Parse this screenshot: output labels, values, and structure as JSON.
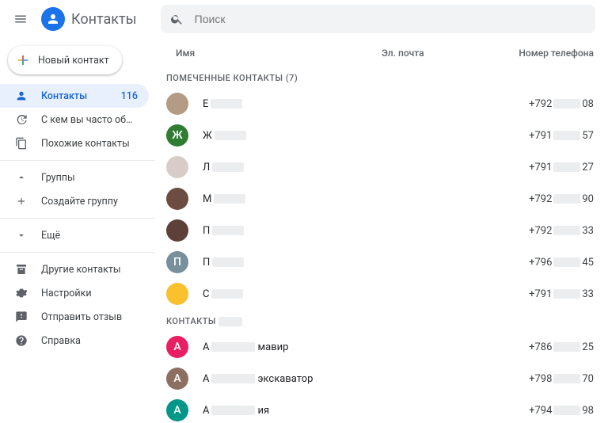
{
  "header": {
    "app_title": "Контакты",
    "search_placeholder": "Поиск"
  },
  "new_button": {
    "label": "Новый контакт"
  },
  "sidebar": {
    "items": [
      {
        "icon": "person",
        "label": "Контакты",
        "badge": "116",
        "active": true
      },
      {
        "icon": "history",
        "label": "С кем вы часто общае…"
      },
      {
        "icon": "copy",
        "label": "Похожие контакты"
      }
    ],
    "groups": [
      {
        "icon": "chev-up",
        "label": "Группы"
      },
      {
        "icon": "plus",
        "label": "Создайте группу"
      }
    ],
    "more": [
      {
        "icon": "chev-down",
        "label": "Ещё"
      }
    ],
    "footer": [
      {
        "icon": "archive",
        "label": "Другие контакты"
      },
      {
        "icon": "gear",
        "label": "Настройки"
      },
      {
        "icon": "feedback",
        "label": "Отправить отзыв"
      },
      {
        "icon": "help",
        "label": "Справка"
      }
    ]
  },
  "columns": {
    "name": "Имя",
    "email": "Эл. почта",
    "phone": "Номер телефона"
  },
  "sections": [
    {
      "title": "ПОМЕЧЕННЫЕ КОНТАКТЫ (7)",
      "contacts": [
        {
          "avatar_bg": "#b39b85",
          "initial": "",
          "name_prefix": "Е",
          "phone_prefix": "+792",
          "phone_suffix": "08"
        },
        {
          "avatar_bg": "#2e7d32",
          "initial": "Ж",
          "name_prefix": "Ж",
          "phone_prefix": "+791",
          "phone_suffix": "57"
        },
        {
          "avatar_bg": "#d7ccc8",
          "initial": "",
          "name_prefix": "Л",
          "phone_prefix": "+791",
          "phone_suffix": "27"
        },
        {
          "avatar_bg": "#6d4c41",
          "initial": "",
          "name_prefix": "М",
          "phone_prefix": "+792",
          "phone_suffix": "90"
        },
        {
          "avatar_bg": "#5d4037",
          "initial": "",
          "name_prefix": "П",
          "phone_prefix": "+792",
          "phone_suffix": "33"
        },
        {
          "avatar_bg": "#78909c",
          "initial": "П",
          "name_prefix": "П",
          "phone_prefix": "+796",
          "phone_suffix": "45"
        },
        {
          "avatar_bg": "#fbc02d",
          "initial": "",
          "name_prefix": "С",
          "phone_prefix": "+791",
          "phone_suffix": "33"
        }
      ]
    },
    {
      "title": "КОНТАКТЫ",
      "title_redacted": true,
      "contacts": [
        {
          "avatar_bg": "#e91e63",
          "initial": "А",
          "name_prefix": "А",
          "name_suffix": "мавир",
          "phone_prefix": "+786",
          "phone_suffix": "25"
        },
        {
          "avatar_bg": "#8d6e63",
          "initial": "А",
          "name_prefix": "А",
          "name_suffix": "экскаватор",
          "phone_prefix": "+798",
          "phone_suffix": "70"
        },
        {
          "avatar_bg": "#009688",
          "initial": "А",
          "name_prefix": "А",
          "name_suffix": "ия",
          "phone_prefix": "+794",
          "phone_suffix": "98"
        }
      ]
    }
  ]
}
